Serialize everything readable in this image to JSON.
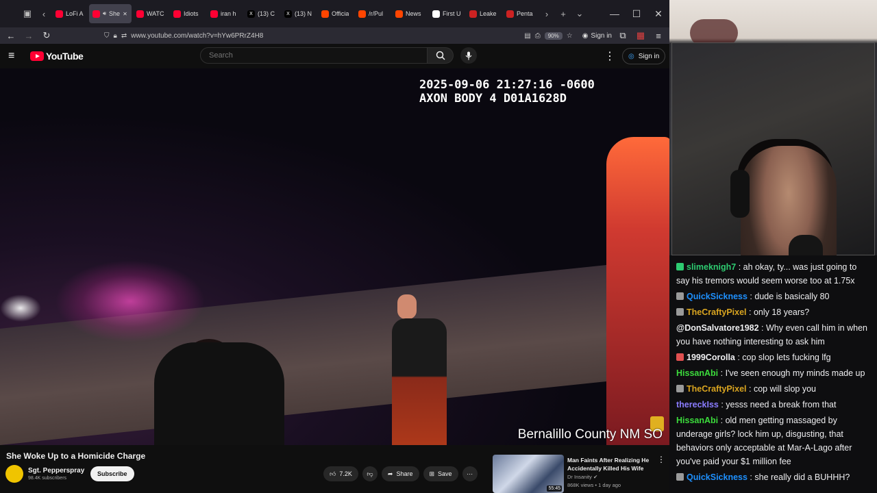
{
  "browser": {
    "tabs": [
      {
        "label": "LoFi A",
        "color": "#ff0033"
      },
      {
        "label": "She",
        "color": "#ff0033",
        "active": true
      },
      {
        "label": "WATC",
        "color": "#ff0033"
      },
      {
        "label": "Idiots",
        "color": "#ff0033"
      },
      {
        "label": "iran h",
        "color": "#ff0033"
      },
      {
        "label": "(13) C",
        "color": "#000000",
        "glyph": "X"
      },
      {
        "label": "(13) N",
        "color": "#000000",
        "glyph": "X"
      },
      {
        "label": "Officia",
        "color": "#ff4500"
      },
      {
        "label": "/r/Pul",
        "color": "#ff4500"
      },
      {
        "label": "News",
        "color": "#ff4500"
      },
      {
        "label": "First U",
        "color": "#ffffff"
      },
      {
        "label": "Leake",
        "color": "#cc2222"
      },
      {
        "label": "Penta",
        "color": "#cc2222"
      }
    ],
    "url": "www.youtube.com/watch?v=hYw6PRrZ4H8",
    "zoom": "90%",
    "signin": "Sign in"
  },
  "youtube": {
    "logo_text": "YouTube",
    "search_placeholder": "Search",
    "signin": "Sign in",
    "video": {
      "timestamp_line1": "2025-09-06 21:27:16 -0600",
      "timestamp_line2": "AXON BODY 4 D01A1628D",
      "agency": "Bernalillo County NM SO"
    },
    "title": "She Woke Up to a Homicide Charge",
    "channel": "Sgt. Pepperspray",
    "subscribers": "98.4K subscribers",
    "subscribe": "Subscribe",
    "likes": "7.2K",
    "share": "Share",
    "save": "Save",
    "recommended": {
      "title": "Man Faints After Realizing He Accidentally Killed His Wife",
      "channel": "Dr Insanity",
      "meta": "868K views • 1 day ago",
      "duration": "55:45"
    }
  },
  "chat": [
    {
      "user": "slimeknigh7",
      "color": "#2ecc71",
      "badge": "#2ecc71",
      "text": "ah okay, ty... was just going to say his tremors would seem worse too at 1.75x"
    },
    {
      "user": "QuickSickness",
      "color": "#1e90ff",
      "badge": "#9a9a9a",
      "text": "dude is basically 80"
    },
    {
      "user": "TheCraftyPixel",
      "color": "#daa520",
      "badge": "#9a9a9a",
      "text": "only 18 years?"
    },
    {
      "user": "@DonSalvatore1982",
      "color": "#efeff1",
      "badge": "",
      "text": "Why even call him in when you have nothing interesting to ask him"
    },
    {
      "user": "1999Corolla",
      "color": "#efeff1",
      "badge": "#e05050",
      "text": "cop slop lets fucking lfg"
    },
    {
      "user": "HissanAbi",
      "color": "#3cdc3c",
      "badge": "",
      "text": "I've seen enough my minds made up"
    },
    {
      "user": "TheCraftyPixel",
      "color": "#daa520",
      "badge": "#9a9a9a",
      "text": "cop will slop you"
    },
    {
      "user": "thereckIss",
      "color": "#8a7cff",
      "badge": "",
      "text": "yesss need a break from that"
    },
    {
      "user": "HissanAbi",
      "color": "#3cdc3c",
      "badge": "",
      "text": "old men getting massaged by underage girls? lock him up, disgusting, that behaviors only acceptable at Mar-A-Lago after you've paid your $1 million fee"
    },
    {
      "user": "QuickSickness",
      "color": "#1e90ff",
      "badge": "#9a9a9a",
      "text": "she really did a BUHHH?"
    }
  ]
}
